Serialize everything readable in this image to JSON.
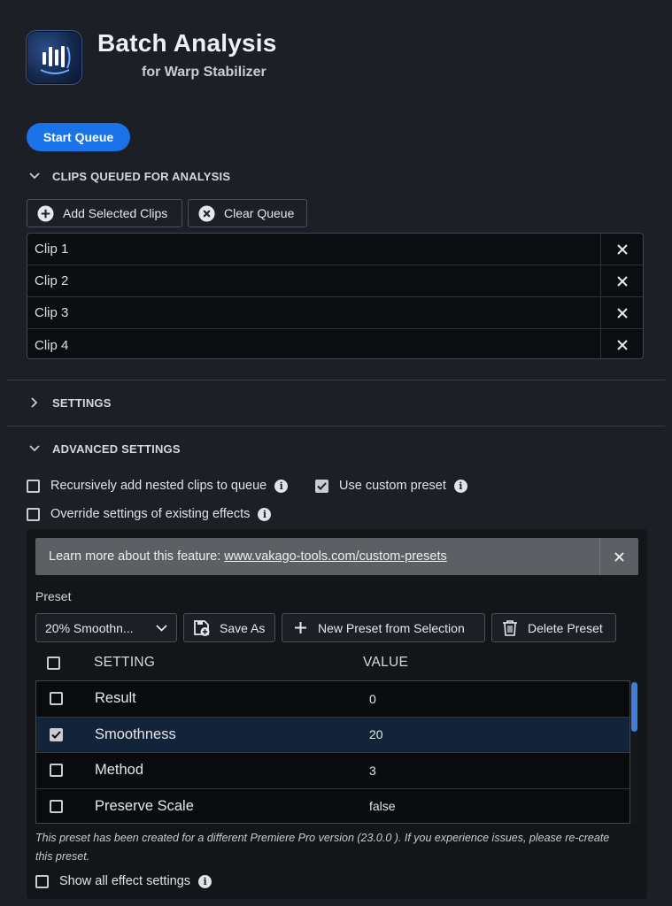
{
  "header": {
    "title": "Batch Analysis",
    "subtitle": "for Warp Stabilizer"
  },
  "actions": {
    "start_queue": "Start Queue"
  },
  "queue_section": {
    "title": "CLIPS QUEUED FOR ANALYSIS",
    "expanded": true,
    "add_selected": "Add Selected Clips",
    "clear_queue": "Clear Queue",
    "clips": [
      {
        "name": "Clip 1"
      },
      {
        "name": "Clip 2"
      },
      {
        "name": "Clip 3"
      },
      {
        "name": "Clip 4"
      }
    ]
  },
  "settings_section": {
    "title": "SETTINGS",
    "expanded": false
  },
  "advanced_section": {
    "title": "ADVANCED SETTINGS",
    "expanded": true,
    "options": {
      "recursive": {
        "label": "Recursively add nested clips to queue",
        "checked": false
      },
      "custom_preset": {
        "label": "Use custom preset",
        "checked": true
      },
      "override": {
        "label": "Override settings of existing effects",
        "checked": false
      }
    },
    "banner": {
      "text": "Learn more about this feature: ",
      "link": "www.vakago-tools.com/custom-presets"
    },
    "preset": {
      "label": "Preset",
      "selected": "20% Smoothn...",
      "save_as": "Save As",
      "new_from_selection": "New Preset from Selection",
      "delete": "Delete Preset"
    },
    "table": {
      "col_setting": "SETTING",
      "col_value": "VALUE",
      "rows": [
        {
          "setting": "Result",
          "value": "0",
          "checked": false,
          "selected": false
        },
        {
          "setting": "Smoothness",
          "value": "20",
          "checked": true,
          "selected": true
        },
        {
          "setting": "Method",
          "value": "3",
          "checked": false,
          "selected": false
        },
        {
          "setting": "Preserve Scale",
          "value": "false",
          "checked": false,
          "selected": false
        }
      ]
    },
    "note": "This preset has been created for a different Premiere Pro version (23.0.0 ). If you experience issues, please re-create this preset.",
    "show_all": {
      "label": "Show all effect settings",
      "checked": false
    }
  },
  "colors": {
    "background": "#1c1f26",
    "accent": "#1a73e8",
    "banner": "#5c5f64",
    "selected_row": "#13243a"
  }
}
